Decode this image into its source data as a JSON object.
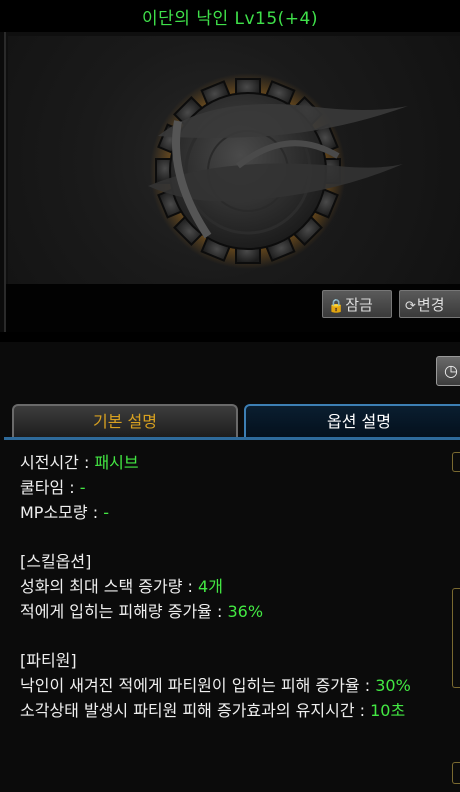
{
  "title": "이단의 낙인 Lv15(+4)",
  "image_buttons": {
    "lock_label": "잠금",
    "change_label": "변경"
  },
  "tabs": [
    {
      "label": "기본 설명",
      "active": false
    },
    {
      "label": "옵션 설명",
      "active": true
    }
  ],
  "details": {
    "cast_time_label": "시전시간 : ",
    "cast_time_value": "패시브",
    "cooldown_label": "쿨타임 : ",
    "cooldown_value": "-",
    "mp_label": "MP소모량 : ",
    "mp_value": "-"
  },
  "skill_options": {
    "header": "[스킬옵션]",
    "line1_label": "성화의 최대 스택 증가량 : ",
    "line1_value": "4개",
    "line2_label": "적에게 입히는 피해량 증가율 : ",
    "line2_value": "36%"
  },
  "party": {
    "header": "[파티원]",
    "line1_label": "낙인이 새겨진 적에게 파티원이 입히는 피해 증가율 : ",
    "line1_value": "30%",
    "line2_label": "소각상태 발생시 파티원 피해 증가효과의 유지시간 : ",
    "line2_value": "10초"
  },
  "colors": {
    "title": "#3fe04a",
    "value": "#43e843",
    "tab_inactive_text": "#d7a020",
    "tab_active_border": "#3d7fb4"
  }
}
